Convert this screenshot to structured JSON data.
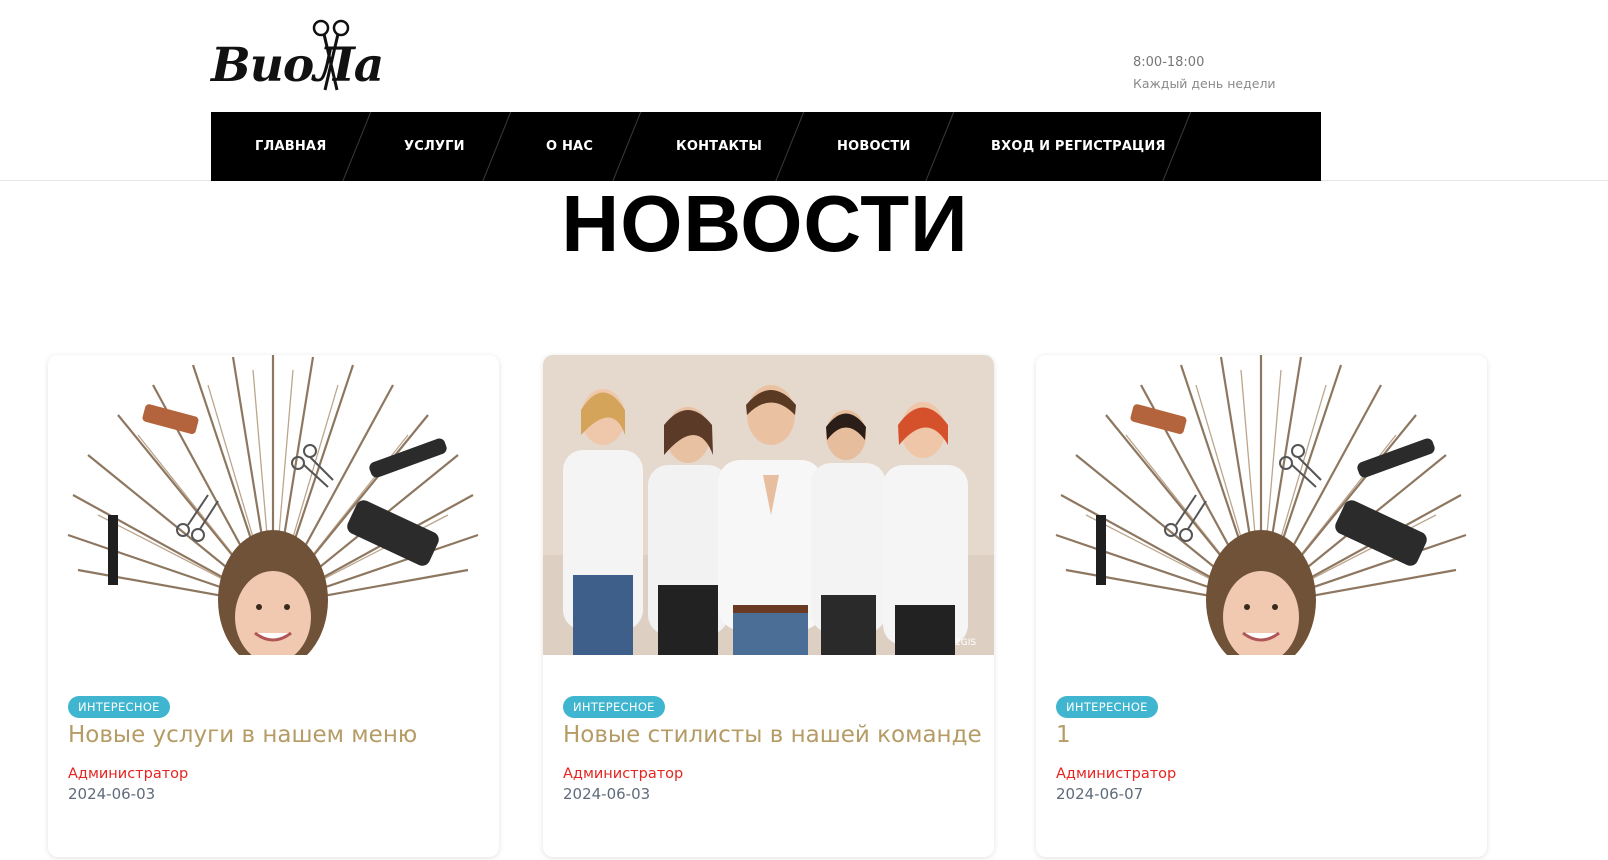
{
  "header": {
    "logo_text": "ВиоЛа",
    "hours": "8:00-18:00",
    "days": "Каждый день недели"
  },
  "nav": {
    "items": [
      {
        "label": "ГЛАВНАЯ"
      },
      {
        "label": "УСЛУГИ"
      },
      {
        "label": "О НАС"
      },
      {
        "label": "КОНТАКТЫ"
      },
      {
        "label": "НОВОСТИ"
      },
      {
        "label": "ВХОД И РЕГИСТРАЦИЯ"
      }
    ]
  },
  "page_title": "НОВОСТИ",
  "cards": [
    {
      "badge": "ИНТЕРЕСНОЕ",
      "title": "Новые услуги в нашем меню",
      "author": "Администратор",
      "date": "2024-06-03"
    },
    {
      "badge": "ИНТЕРЕСНОЕ",
      "title": "Новые стилисты в нашей команде",
      "author": "Администратор",
      "date": "2024-06-03",
      "watermark": "2GIS"
    },
    {
      "badge": "ИНТЕРЕСНОЕ",
      "title": "1",
      "author": "Администратор",
      "date": "2024-06-07"
    }
  ],
  "colors": {
    "nav_bg": "#000000",
    "badge": "#3fb5cf",
    "title": "#b59c66",
    "author": "#e52521",
    "date": "#5f6b7a"
  }
}
